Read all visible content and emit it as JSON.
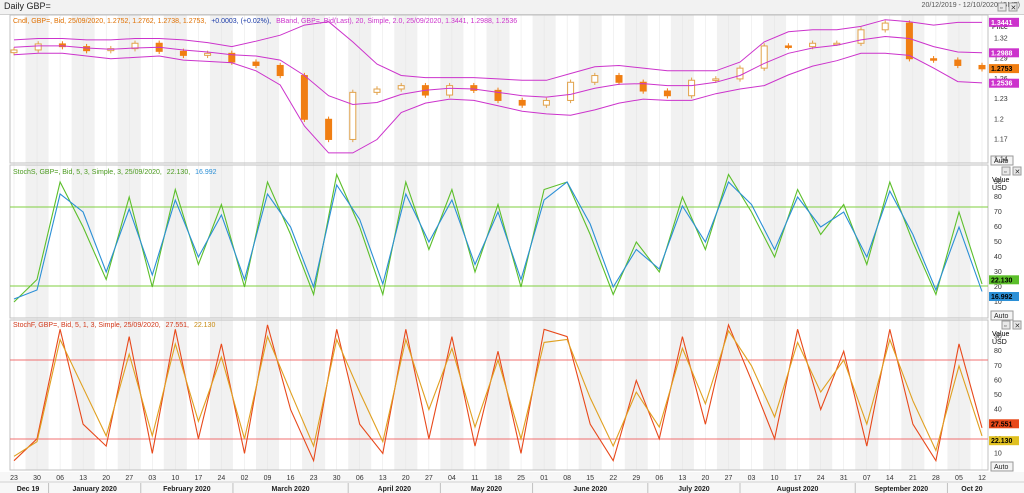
{
  "window": {
    "title": "Daily GBP=",
    "date_range": "20/12/2019 - 12/10/2020 (GMT)"
  },
  "colors": {
    "candle_up": "#e2a24a",
    "candle_down": "#f07e12",
    "bband": "#cc33cc",
    "stoch_slow_k": "#5cbf2a",
    "stoch_slow_d": "#2b8fd6",
    "stoch_fast_k": "#e8481a",
    "stoch_fast_d": "#e0a020",
    "level_line_slow": "#7fcf3f",
    "level_line_fast": "#f07070",
    "shade": "#f1f1f1",
    "grid": "#e4e4e4"
  },
  "panels": {
    "price": {
      "legend": {
        "candle": "Cndl, GBP=, Bid, 25/09/2020, 1.2752, 1.2762, 1.2738, 1.2753,",
        "change": "+0.0003, (+0.02%),",
        "bband": "BBand, GBP=, Bid(Last), 20, Simple, 2.0, 25/09/2020, 1.3441, 1.2988, 1.2536"
      },
      "axis_title": "Price",
      "ticks": [
        "1.32",
        "1.29",
        "1.26",
        "1.23",
        "1.2",
        "1.17",
        "1.14"
      ],
      "badges": {
        "upper": "1.3441",
        "middle": "1.2988",
        "last": "1.2753",
        "lower": "1.2536"
      },
      "auto_label": "Auto"
    },
    "slow": {
      "legend": {
        "prefix": "StochS, GBP=, Bid, 5, 3, Simple, 3, 25/09/2020,",
        "k": "22.130,",
        "d": "16.992"
      },
      "axis_title": "Value",
      "axis_unit": "USD",
      "ticks": [
        "90",
        "80",
        "70",
        "60",
        "50",
        "40",
        "30",
        "20",
        "10"
      ],
      "badges": {
        "k": "22.130",
        "d": "16.992"
      },
      "auto_label": "Auto"
    },
    "fast": {
      "legend": {
        "prefix": "StochF, GBP=, Bid, 5, 1, 3, Simple, 25/09/2020,",
        "k": "27.551,",
        "d": "22.130"
      },
      "axis_title": "Value",
      "axis_unit": "USD",
      "ticks": [
        "90",
        "80",
        "70",
        "60",
        "50",
        "40",
        "30",
        "20",
        "10"
      ],
      "badges": {
        "k": "27.551",
        "d": "22.130"
      },
      "auto_label": "Auto"
    }
  },
  "x_axis": {
    "day_labels": [
      "23",
      "30",
      "06",
      "13",
      "20",
      "27",
      "03",
      "10",
      "17",
      "24",
      "02",
      "09",
      "16",
      "23",
      "30",
      "06",
      "13",
      "20",
      "27",
      "04",
      "11",
      "18",
      "25",
      "01",
      "08",
      "15",
      "22",
      "29",
      "06",
      "13",
      "20",
      "27",
      "03",
      "10",
      "17",
      "24",
      "31",
      "07",
      "14",
      "21",
      "28",
      "05",
      "12"
    ],
    "month_labels": [
      "Dec 19",
      "January 2020",
      "February 2020",
      "March 2020",
      "April 2020",
      "May 2020",
      "June 2020",
      "July 2020",
      "August 2020",
      "September 2020",
      "Oct 20"
    ]
  },
  "chart_data": [
    {
      "type": "candlestick",
      "title": "Daily GBP=",
      "ylabel": "Price",
      "ylim": [
        1.135,
        1.355
      ],
      "x": [
        "2019-12-23",
        "2019-12-30",
        "2020-01-06",
        "2020-01-13",
        "2020-01-20",
        "2020-01-27",
        "2020-02-03",
        "2020-02-10",
        "2020-02-17",
        "2020-02-24",
        "2020-03-02",
        "2020-03-09",
        "2020-03-16",
        "2020-03-23",
        "2020-03-30",
        "2020-04-06",
        "2020-04-13",
        "2020-04-20",
        "2020-04-27",
        "2020-05-04",
        "2020-05-11",
        "2020-05-18",
        "2020-05-25",
        "2020-06-01",
        "2020-06-08",
        "2020-06-15",
        "2020-06-22",
        "2020-06-29",
        "2020-07-06",
        "2020-07-13",
        "2020-07-20",
        "2020-07-27",
        "2020-08-03",
        "2020-08-10",
        "2020-08-17",
        "2020-08-24",
        "2020-08-31",
        "2020-09-07",
        "2020-09-14",
        "2020-09-21",
        "2020-09-25"
      ],
      "series": [
        {
          "name": "Cndl",
          "values": [
            1.303,
            1.312,
            1.308,
            1.302,
            1.305,
            1.313,
            1.301,
            1.295,
            1.298,
            1.285,
            1.28,
            1.265,
            1.2,
            1.17,
            1.24,
            1.245,
            1.25,
            1.236,
            1.25,
            1.243,
            1.228,
            1.221,
            1.228,
            1.255,
            1.265,
            1.255,
            1.242,
            1.235,
            1.258,
            1.26,
            1.276,
            1.309,
            1.308,
            1.313,
            1.313,
            1.333,
            1.343,
            1.29,
            1.288,
            1.28,
            1.275
          ]
        },
        {
          "name": "BBand Upper",
          "values": [
            1.318,
            1.32,
            1.32,
            1.318,
            1.318,
            1.32,
            1.32,
            1.318,
            1.314,
            1.308,
            1.316,
            1.325,
            1.34,
            1.345,
            1.315,
            1.282,
            1.265,
            1.262,
            1.262,
            1.262,
            1.26,
            1.258,
            1.258,
            1.268,
            1.278,
            1.28,
            1.276,
            1.272,
            1.272,
            1.272,
            1.285,
            1.315,
            1.33,
            1.333,
            1.333,
            1.338,
            1.348,
            1.345,
            1.34,
            1.344,
            1.344
          ]
        },
        {
          "name": "BBand Middle",
          "values": [
            1.307,
            1.309,
            1.309,
            1.306,
            1.304,
            1.306,
            1.307,
            1.303,
            1.3,
            1.296,
            1.294,
            1.288,
            1.265,
            1.235,
            1.222,
            1.225,
            1.237,
            1.243,
            1.246,
            1.245,
            1.24,
            1.235,
            1.233,
            1.237,
            1.246,
            1.252,
            1.253,
            1.25,
            1.25,
            1.255,
            1.265,
            1.283,
            1.298,
            1.306,
            1.31,
            1.318,
            1.323,
            1.32,
            1.308,
            1.3,
            1.299
          ]
        },
        {
          "name": "BBand Lower",
          "values": [
            1.296,
            1.298,
            1.298,
            1.294,
            1.29,
            1.292,
            1.294,
            1.288,
            1.286,
            1.284,
            1.272,
            1.251,
            1.19,
            1.15,
            1.15,
            1.17,
            1.21,
            1.224,
            1.23,
            1.228,
            1.22,
            1.212,
            1.208,
            1.206,
            1.214,
            1.224,
            1.23,
            1.228,
            1.228,
            1.238,
            1.245,
            1.25,
            1.266,
            1.279,
            1.287,
            1.298,
            1.298,
            1.295,
            1.276,
            1.256,
            1.254
          ]
        }
      ]
    },
    {
      "type": "line",
      "title": "StochS",
      "ylim": [
        0,
        100
      ],
      "reference_lines": [
        20,
        80
      ],
      "series": [
        {
          "name": "StochS %K",
          "values": [
            10,
            25,
            90,
            60,
            25,
            80,
            20,
            85,
            35,
            75,
            20,
            90,
            55,
            15,
            95,
            60,
            15,
            90,
            45,
            85,
            30,
            75,
            20,
            85,
            90,
            55,
            15,
            50,
            30,
            80,
            45,
            95,
            70,
            40,
            85,
            55,
            75,
            35,
            90,
            50,
            15,
            70,
            22
          ]
        },
        {
          "name": "StochS %D",
          "values": [
            12,
            18,
            82,
            70,
            30,
            72,
            28,
            78,
            40,
            68,
            25,
            82,
            60,
            20,
            88,
            65,
            22,
            82,
            50,
            78,
            35,
            70,
            25,
            78,
            90,
            62,
            20,
            45,
            32,
            74,
            50,
            90,
            75,
            45,
            80,
            60,
            70,
            40,
            84,
            55,
            18,
            60,
            17
          ]
        }
      ]
    },
    {
      "type": "line",
      "title": "StochF",
      "ylim": [
        0,
        100
      ],
      "reference_lines": [
        20,
        80
      ],
      "series": [
        {
          "name": "StochF %K",
          "values": [
            5,
            20,
            95,
            30,
            15,
            90,
            10,
            95,
            20,
            85,
            10,
            98,
            40,
            5,
            95,
            30,
            10,
            95,
            20,
            90,
            15,
            80,
            10,
            95,
            90,
            30,
            5,
            60,
            20,
            90,
            30,
            98,
            60,
            20,
            95,
            40,
            80,
            15,
            95,
            30,
            5,
            85,
            27.5
          ]
        },
        {
          "name": "StochF %D",
          "values": [
            8,
            18,
            88,
            55,
            22,
            78,
            22,
            85,
            32,
            76,
            20,
            90,
            52,
            15,
            88,
            52,
            18,
            88,
            40,
            82,
            28,
            74,
            20,
            86,
            88,
            48,
            15,
            52,
            28,
            82,
            44,
            94,
            70,
            35,
            86,
            52,
            74,
            30,
            88,
            46,
            12,
            70,
            22
          ]
        }
      ]
    }
  ]
}
